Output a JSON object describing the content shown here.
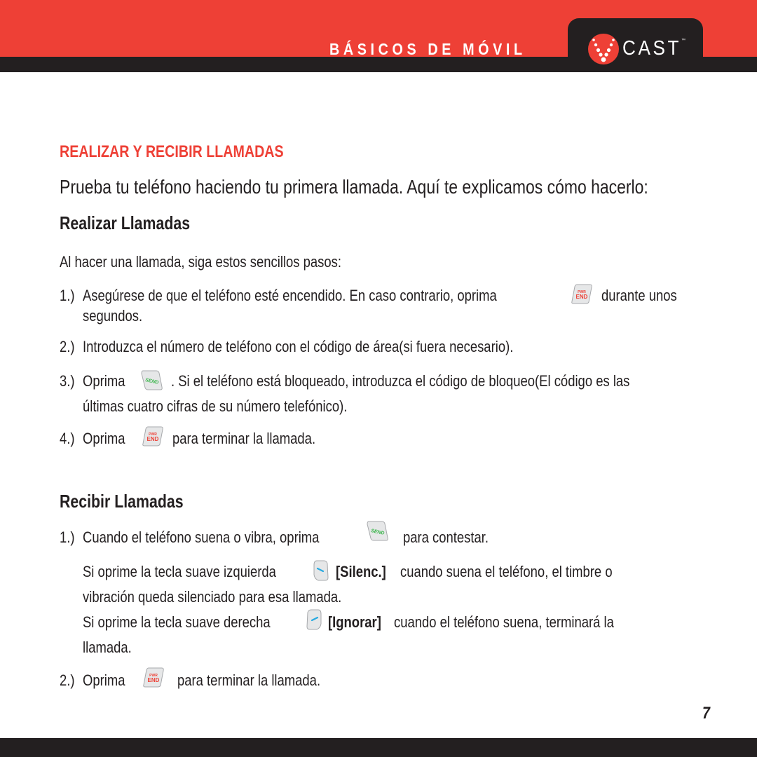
{
  "header": {
    "title": "BÁSICOS DE MÓVIL",
    "logo_text": "CAST",
    "logo_tm": "™",
    "brand_red": "#ee4036",
    "bar_black": "#231f20"
  },
  "section": {
    "heading": "REALIZAR Y RECIBIR LLAMADAS",
    "intro": "Prueba tu teléfono haciendo tu primera llamada. Aquí te explicamos cómo hacerlo:"
  },
  "make_calls": {
    "title": "Realizar Llamadas",
    "lead": "Al hacer una llamada, siga estos sencillos pasos:",
    "steps": [
      {
        "number": "1.)",
        "before_key": "Asegúrese de que el teléfono esté encendido. En caso contrario, oprima",
        "key": "pwr-end-key-icon",
        "after_key": "durante unos",
        "continuation": "segundos."
      },
      {
        "number": "2.)",
        "text": "Introduzca el número de teléfono con el código de área(si fuera necesario)."
      },
      {
        "number": "3.)",
        "before_key": "Oprima",
        "key": "send-key-icon",
        "after_key": ". Si el teléfono está bloqueado, introduzca el código de bloqueo(El código es las",
        "continuation": "últimas cuatro cifras de su número telefónico)."
      },
      {
        "number": "4.)",
        "before_key": "Oprima",
        "key": "pwr-end-key-icon",
        "after_key": "para terminar la llamada."
      }
    ]
  },
  "receive_calls": {
    "title": "Recibir Llamadas",
    "steps": [
      {
        "number": "1.)",
        "before_key": "Cuando el teléfono suena o vibra, oprima",
        "key": "send-key-icon",
        "after_key": "para contestar."
      },
      {
        "number": "2.)",
        "before_key": "Oprima",
        "key": "pwr-end-key-icon",
        "after_key": "para terminar la llamada."
      }
    ],
    "notes": [
      {
        "before_key": "Si oprime la tecla suave izquierda",
        "key": "left-soft-key-icon",
        "bold_label": "[Silenc.]",
        "after_label": "cuando suena el teléfono, el timbre o",
        "continuation": "vibración queda silenciado para esa llamada."
      },
      {
        "before_key": "Si oprime la tecla suave derecha",
        "key": "right-soft-key-icon",
        "bold_label": "[Ignorar]",
        "after_label": "cuando el teléfono suena, terminará la",
        "continuation": "llamada."
      }
    ]
  },
  "key_labels": {
    "pwr": "PWR",
    "end": "END",
    "send": "SEND"
  },
  "footer": {
    "page_number": "7"
  }
}
